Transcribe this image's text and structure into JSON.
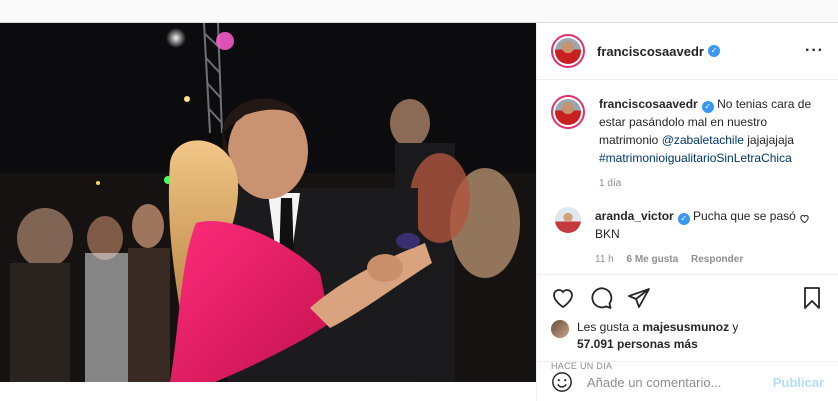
{
  "header": {
    "username": "franciscosaavedr",
    "verified_icon": "verified-badge-icon",
    "more_icon": "more-options-icon"
  },
  "caption": {
    "username": "franciscosaavedr",
    "text_start": "No tenias cara de estar pasándolo mal en nuestro matrimonio ",
    "mention": "@zabaletachile",
    "text_mid": " jajajajaja ",
    "hashtag": "#matrimonioigualitarioSinLetraChica",
    "time": "1 día"
  },
  "comments": [
    {
      "username": "aranda_victor",
      "text": "Pucha que se pasó BKN",
      "time": "11 h",
      "likes": "6 Me gusta",
      "reply": "Responder"
    }
  ],
  "actions": {
    "like_icon": "heart-icon",
    "comment_icon": "comment-icon",
    "share_icon": "share-icon",
    "save_icon": "bookmark-icon"
  },
  "likes": {
    "prefix": "Les gusta a ",
    "user": "majesusmunoz",
    "connector": " y",
    "count": "57.091 personas más"
  },
  "posted": "HACE UN DÍA",
  "add_comment": {
    "placeholder": "Añade un comentario...",
    "publish": "Publicar"
  },
  "colors": {
    "accent": "#3897f0",
    "publish_disabled": "#b2dffc",
    "link": "#00376b"
  }
}
